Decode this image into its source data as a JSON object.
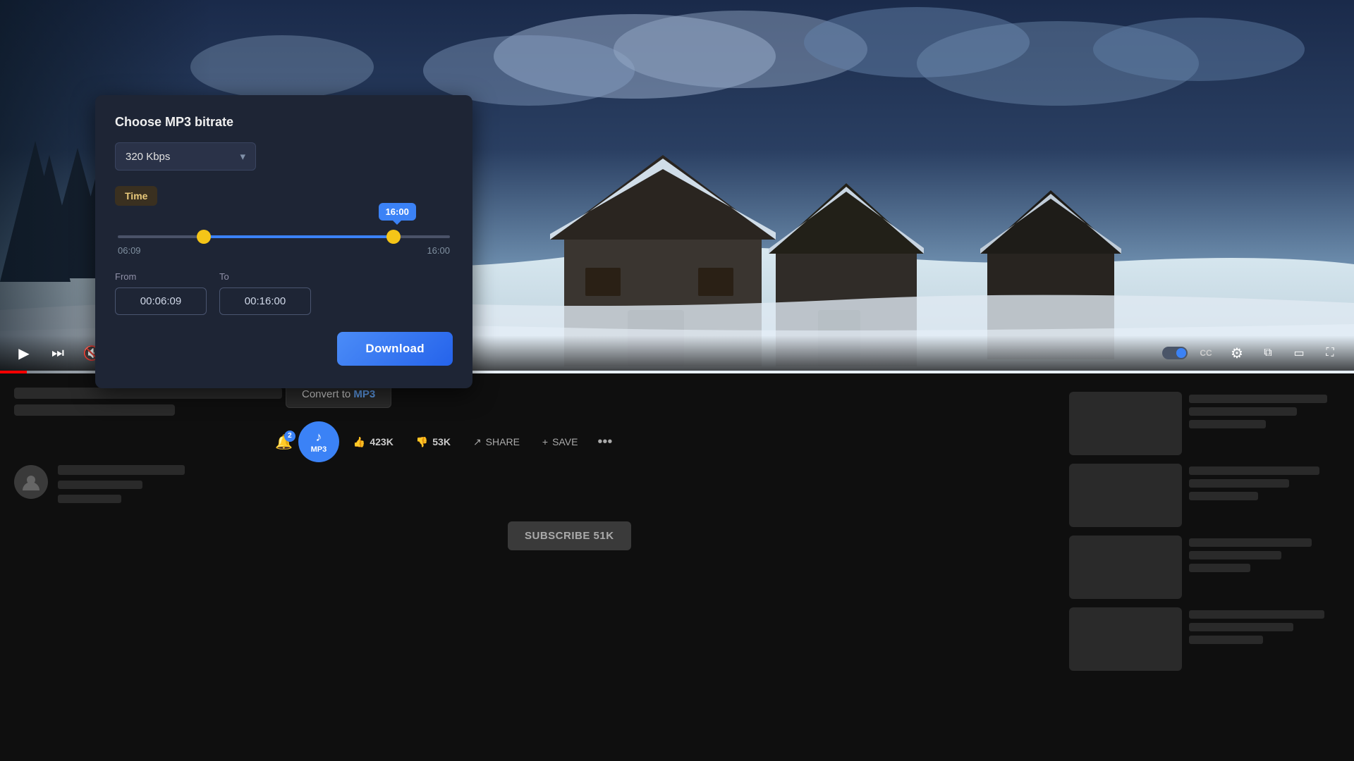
{
  "modal": {
    "title": "Choose MP3 bitrate",
    "bitrate_label": "320 Kbps",
    "time_section_label": "Time",
    "tooltip_value": "16:00",
    "slider_left_label": "06:09",
    "slider_right_label": "16:00",
    "from_label": "From",
    "to_label": "To",
    "from_value": "00:06:09",
    "to_value": "00:16:00",
    "download_btn": "Download",
    "dropdown_chevron": "▾"
  },
  "convert_btn": {
    "label_prefix": "Convert to ",
    "label_bold": "MP3"
  },
  "action_bar": {
    "bell_badge": "2",
    "mp3_icon": "♪",
    "mp3_label": "MP3",
    "like_count": "423K",
    "dislike_count": "53K",
    "share_label": "SHARE",
    "save_label": "SAVE",
    "more_icon": "•••"
  },
  "subscribe_btn": "SUBSCRIBE 51K",
  "video_controls": {
    "play_icon": "▶",
    "skip_icon": "⏭",
    "mute_icon": "🔇",
    "miniplayer_icon": "⧉",
    "theater_icon": "▭",
    "fullscreen_icon": "⛶",
    "settings_icon": "⚙",
    "captions_icon": "CC",
    "autoplay_icon": "⟳"
  }
}
